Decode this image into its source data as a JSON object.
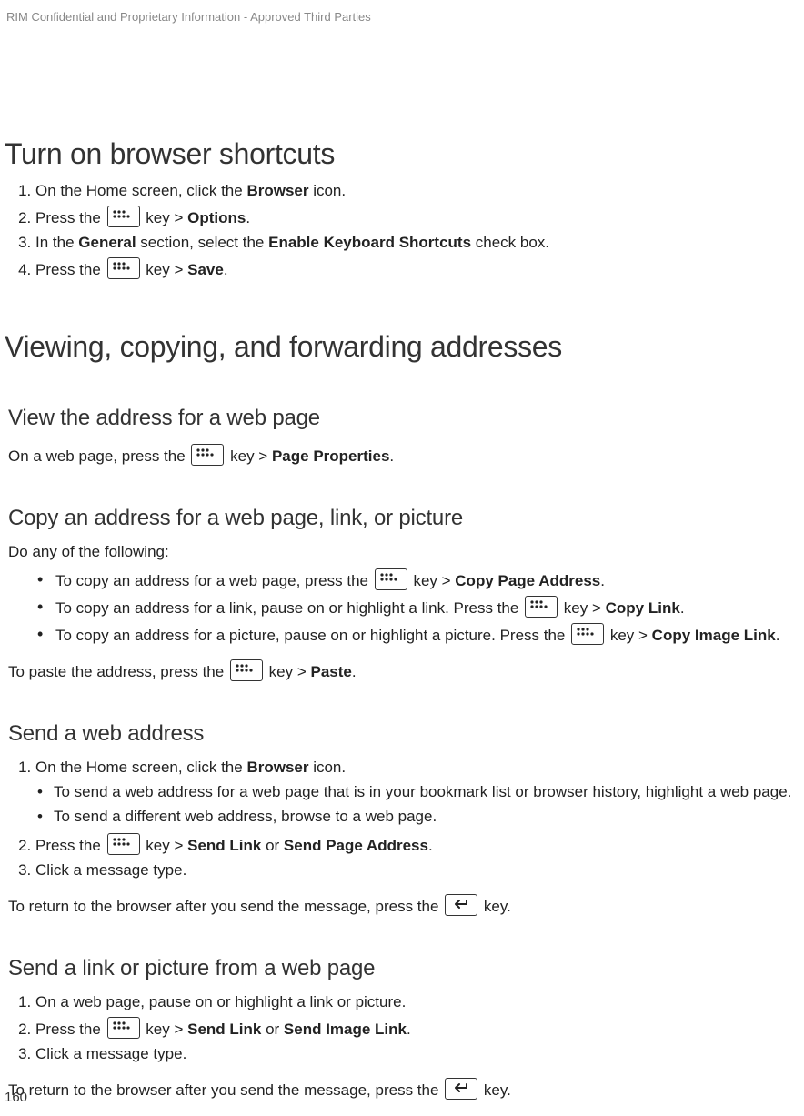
{
  "header": {
    "confidential": "RIM Confidential and Proprietary Information - Approved Third Parties"
  },
  "footer": {
    "page_number": "160"
  },
  "key_glyphs": {
    "menu_key_alt": "Menu key",
    "back_key_alt": "Escape key"
  },
  "sections": {
    "turn_on": {
      "title": "Turn on browser shortcuts",
      "steps": {
        "s1_a": "On the Home screen, click the ",
        "s1_b": "Browser",
        "s1_c": " icon.",
        "s2_a": "Press the ",
        "s2_b": " key > ",
        "s2_c": "Options",
        "s2_d": ".",
        "s3_a": "In the ",
        "s3_b": "General",
        "s3_c": " section, select the ",
        "s3_d": "Enable Keyboard Shortcuts",
        "s3_e": " check box.",
        "s4_a": "Press the ",
        "s4_b": " key > ",
        "s4_c": "Save",
        "s4_d": "."
      }
    },
    "vcf": {
      "title": "Viewing, copying, and forwarding addresses"
    },
    "view_addr": {
      "title": "View the address for a web page",
      "p_a": "On a web page, press the ",
      "p_b": " key > ",
      "p_c": "Page Properties",
      "p_d": "."
    },
    "copy_addr": {
      "title": "Copy an address for a web page, link, or picture",
      "lead": "Do any of the following:",
      "b1_a": "To copy an address for a web page, press the ",
      "b1_b": " key > ",
      "b1_c": "Copy Page Address",
      "b1_d": ".",
      "b2_a": "To copy an address for a link, pause on or highlight a link. Press the ",
      "b2_b": " key > ",
      "b2_c": "Copy Link",
      "b2_d": ".",
      "b3_a": "To copy an address for a picture, pause on or highlight a picture. Press the ",
      "b3_b": " key > ",
      "b3_c": "Copy Image Link",
      "b3_d": ".",
      "paste_a": "To paste the address, press the ",
      "paste_b": " key > ",
      "paste_c": "Paste",
      "paste_d": "."
    },
    "send_addr": {
      "title": "Send a web address",
      "s1_a": "On the Home screen, click the ",
      "s1_b": "Browser",
      "s1_c": " icon.",
      "sb1": "To send a web address for a web page that is in your bookmark list or browser history, highlight a web page.",
      "sb2": "To send a different web address, browse to a web page.",
      "s2_a": "Press the ",
      "s2_b": " key > ",
      "s2_c": "Send Link",
      "s2_d": " or ",
      "s2_e": "Send Page Address",
      "s2_f": ".",
      "s3": "Click a message type.",
      "ret_a": "To return to the browser after you send the message, press the ",
      "ret_b": " key."
    },
    "send_link_pic": {
      "title": "Send a link or picture from a web page",
      "s1": "On a web page, pause on or highlight a link or picture.",
      "s2_a": "Press the ",
      "s2_b": " key > ",
      "s2_c": "Send Link",
      "s2_d": " or ",
      "s2_e": "Send Image Link",
      "s2_f": ".",
      "s3": "Click a message type.",
      "ret_a": "To return to the browser after you send the message, press the ",
      "ret_b": " key."
    }
  }
}
